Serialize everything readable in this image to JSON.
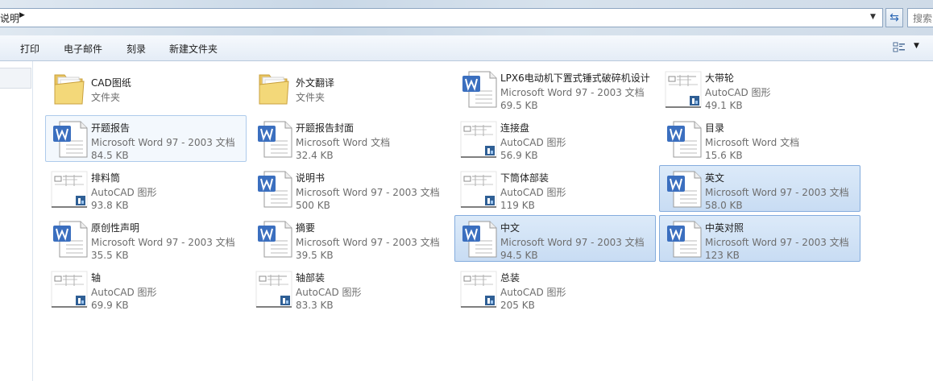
{
  "address": {
    "path": "说明",
    "search_placeholder": "搜索"
  },
  "toolbar": {
    "items": [
      "打印",
      "电子邮件",
      "刻录",
      "新建文件夹"
    ]
  },
  "files": [
    {
      "name": "CAD图纸",
      "type": "文件夹",
      "size": "",
      "kind": "folder",
      "state": "normal"
    },
    {
      "name": "外文翻译",
      "type": "文件夹",
      "size": "",
      "kind": "folder",
      "state": "normal"
    },
    {
      "name": "LPX6电动机下置式锤式破碎机设计",
      "type": "Microsoft Word 97 - 2003 文档",
      "size": "69.5 KB",
      "kind": "word",
      "state": "normal"
    },
    {
      "name": "大带轮",
      "type": "AutoCAD 图形",
      "size": "49.1 KB",
      "kind": "cad",
      "state": "normal"
    },
    {
      "name": "开题报告",
      "type": "Microsoft Word 97 - 2003 文档",
      "size": "84.5 KB",
      "kind": "word",
      "state": "focus"
    },
    {
      "name": "开题报告封面",
      "type": "Microsoft Word 文档",
      "size": "32.4 KB",
      "kind": "word",
      "state": "normal"
    },
    {
      "name": "连接盘",
      "type": "AutoCAD 图形",
      "size": "56.9 KB",
      "kind": "cad",
      "state": "normal"
    },
    {
      "name": "目录",
      "type": "Microsoft Word 文档",
      "size": "15.6 KB",
      "kind": "word",
      "state": "normal"
    },
    {
      "name": "排料筒",
      "type": "AutoCAD 图形",
      "size": "93.8 KB",
      "kind": "cad",
      "state": "normal"
    },
    {
      "name": "说明书",
      "type": "Microsoft Word 97 - 2003 文档",
      "size": "500 KB",
      "kind": "word",
      "state": "normal"
    },
    {
      "name": "下筒体部装",
      "type": "AutoCAD 图形",
      "size": "119 KB",
      "kind": "cad",
      "state": "normal"
    },
    {
      "name": "英文",
      "type": "Microsoft Word 97 - 2003 文档",
      "size": "58.0 KB",
      "kind": "word",
      "state": "selected"
    },
    {
      "name": "原创性声明",
      "type": "Microsoft Word 97 - 2003 文档",
      "size": "35.5 KB",
      "kind": "word",
      "state": "normal"
    },
    {
      "name": "摘要",
      "type": "Microsoft Word 97 - 2003 文档",
      "size": "39.5 KB",
      "kind": "word",
      "state": "normal"
    },
    {
      "name": "中文",
      "type": "Microsoft Word 97 - 2003 文档",
      "size": "94.5 KB",
      "kind": "word",
      "state": "selected"
    },
    {
      "name": "中英对照",
      "type": "Microsoft Word 97 - 2003 文档",
      "size": "123 KB",
      "kind": "word",
      "state": "selected"
    },
    {
      "name": "轴",
      "type": "AutoCAD 图形",
      "size": "69.9 KB",
      "kind": "cad",
      "state": "normal"
    },
    {
      "name": "轴部装",
      "type": "AutoCAD 图形",
      "size": "83.3 KB",
      "kind": "cad",
      "state": "normal"
    },
    {
      "name": "总装",
      "type": "AutoCAD 图形",
      "size": "205 KB",
      "kind": "cad",
      "state": "normal"
    }
  ]
}
